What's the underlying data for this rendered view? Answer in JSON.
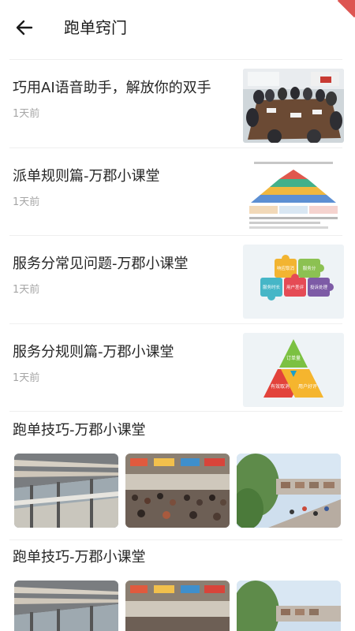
{
  "header": {
    "title": "跑单窍门",
    "back_icon": "arrow-left-icon",
    "accent": "#d9443f"
  },
  "articles": [
    {
      "title": "巧用AI语音助手，解放你的双手",
      "time": "1天前",
      "thumb": "meeting-photo"
    },
    {
      "title": "派单规则篇-万郡小课堂",
      "time": "1天前",
      "thumb": "pyramid-diagram"
    },
    {
      "title": "服务分常见问题-万郡小课堂",
      "time": "1天前",
      "thumb": "puzzle-pieces"
    },
    {
      "title": "服务分规则篇-万郡小课堂",
      "time": "1天前",
      "thumb": "triangle-diagram"
    }
  ],
  "galleries": [
    {
      "title": "跑单技巧-万郡小课堂",
      "images": [
        "airport-terminal-photo",
        "station-crowd-photo",
        "street-market-photo"
      ]
    },
    {
      "title": "跑单技巧-万郡小课堂",
      "images": [
        "airport-terminal-photo",
        "station-crowd-photo",
        "street-market-photo"
      ]
    }
  ],
  "thumbnail_text": {
    "puzzle": [
      "响应取消",
      "服务分",
      "服务时长",
      "用户差评",
      "投诉处理"
    ],
    "triangle": [
      "订单量",
      "有效取消",
      "用户好评"
    ]
  }
}
